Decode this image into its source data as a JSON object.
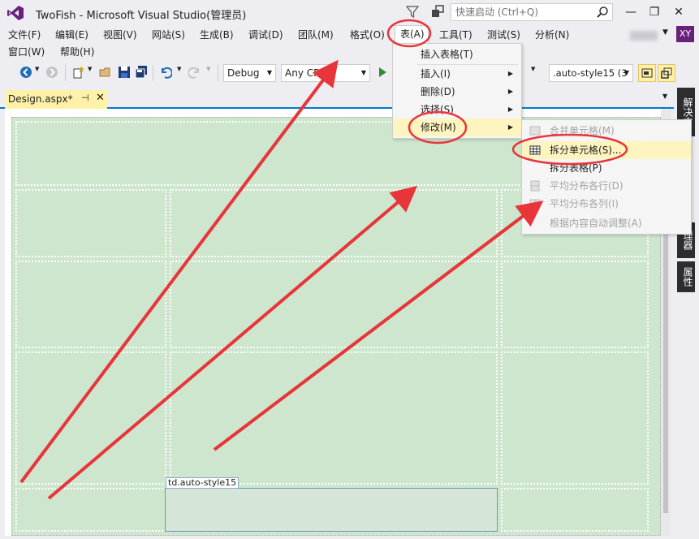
{
  "window": {
    "title": "TwoFish - Microsoft Visual Studio(管理员)",
    "quick_launch_placeholder": "快速启动 (Ctrl+Q)",
    "user_initials": "XY",
    "icons": [
      "vs-logo-icon",
      "filter-icon",
      "notification-icon",
      "search-icon",
      "minimize-icon",
      "restore-icon",
      "close-icon"
    ]
  },
  "menubar": {
    "items": [
      "文件(F)",
      "编辑(E)",
      "视图(V)",
      "网站(S)",
      "生成(B)",
      "调试(D)",
      "团队(M)",
      "格式(O)",
      "表(A)",
      "工具(T)",
      "测试(S)",
      "分析(N)"
    ],
    "row2": [
      "窗口(W)",
      "帮助(H)"
    ],
    "active": "表(A)"
  },
  "toolbar": {
    "config": "Debug",
    "platform": "Any CPU",
    "style_combo": ".auto-style15 (3"
  },
  "document": {
    "tab_label": "Design.aspx*",
    "selected_element_tag": "td.auto-style15"
  },
  "side_panels": [
    "解决方",
    "理器",
    "属性"
  ],
  "table_menu": {
    "items": [
      {
        "label": "插入表格(T)",
        "submenu": false
      },
      {
        "label": "插入(I)",
        "submenu": true
      },
      {
        "label": "删除(D)",
        "submenu": true
      },
      {
        "label": "选择(S)",
        "submenu": true
      },
      {
        "label": "修改(M)",
        "submenu": true,
        "highlighted": true
      }
    ]
  },
  "modify_submenu": {
    "items": [
      {
        "label": "合并单元格(M)",
        "enabled": false
      },
      {
        "label": "拆分单元格(S)...",
        "enabled": true,
        "highlighted": true
      },
      {
        "label": "拆分表格(P)",
        "enabled": true
      },
      {
        "label": "平均分布各行(D)",
        "enabled": false
      },
      {
        "label": "平均分布各列(I)",
        "enabled": false
      },
      {
        "label": "根据内容自动调整(A)",
        "enabled": false
      }
    ]
  },
  "annotation_color": "#e8353a"
}
